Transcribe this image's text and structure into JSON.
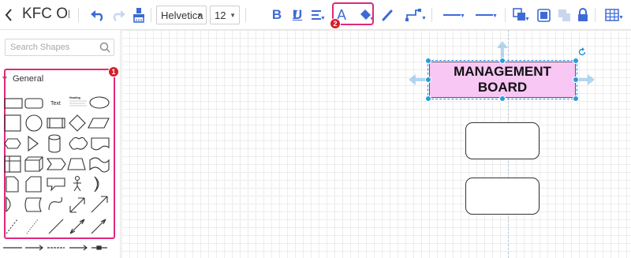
{
  "header": {
    "title": "KFC Org",
    "font_family_value": "Helvetica",
    "font_size_value": "12",
    "bold_label": "B",
    "italic_label": "I",
    "underline_label": "U",
    "font_color_label": "A"
  },
  "sidebar": {
    "search_placeholder": "Search Shapes",
    "section_label": "General",
    "text_shape_label": "Text",
    "heading_shape_label": "Heading"
  },
  "annotations": {
    "badge_1": "1",
    "badge_2": "2"
  },
  "canvas": {
    "nodes": [
      {
        "label_line1": "MANAGEMENT",
        "label_line2": "BOARD"
      },
      {
        "label_line1": "",
        "label_line2": ""
      },
      {
        "label_line1": "",
        "label_line2": ""
      }
    ]
  },
  "colors": {
    "accent": "#3d6bd6",
    "highlight": "#e0287a",
    "badge": "#d41f2a",
    "selected_fill": "#f8c7f4",
    "handle": "#2a9be0"
  }
}
